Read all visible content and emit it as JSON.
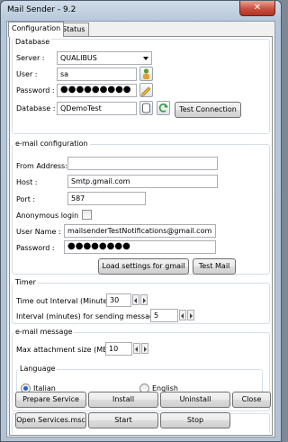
{
  "window": {
    "title": "Mail Sender - 9.2",
    "close_glyph": "✕"
  },
  "tabs": [
    {
      "label": "Configuration"
    },
    {
      "label": "Status"
    }
  ],
  "database": {
    "title": "Database",
    "server_label": "Server :",
    "server_value": "QUALIBUS",
    "user_label": "User :",
    "user_value": "sa",
    "password_label": "Password :",
    "password_value": "●●●●●●●●●",
    "database_label": "Database :",
    "database_value": "QDemoTest",
    "test_connection": "Test Connection"
  },
  "email": {
    "title": "e-mail configuration",
    "from_label": "From Address:",
    "from_value": "",
    "host_label": "Host :",
    "host_value": "Smtp.gmail.com",
    "port_label": "Port :",
    "port_value": "587",
    "anonymous_label": "Anonymous login",
    "anonymous_checked": false,
    "username_label": "User Name :",
    "username_value": "mailsenderTestNotifications@gmail.com",
    "password_label": "Password :",
    "password_value": "●●●●●●●●",
    "load_gmail": "Load settings for gmail",
    "test_mail": "Test Mail"
  },
  "timer": {
    "title": "Timer",
    "timeout_label": "Time out Interval (Minute) :",
    "timeout_value": "30",
    "interval_label": "Interval (minutes) for sending messages :",
    "interval_value": "5"
  },
  "message": {
    "title": "e-mail message",
    "max_attach_label": "Max attachment size (MB) :",
    "max_attach_value": "10",
    "language_title": "Language",
    "italian_label": "Italian",
    "english_label": "English",
    "selected_language": "Italian"
  },
  "buttons": {
    "prepare": "Prepare Service",
    "install": "Install",
    "uninstall": "Uninstall",
    "close": "Close",
    "open_services": "Open Services.msc",
    "start": "Start",
    "stop": "Stop"
  }
}
